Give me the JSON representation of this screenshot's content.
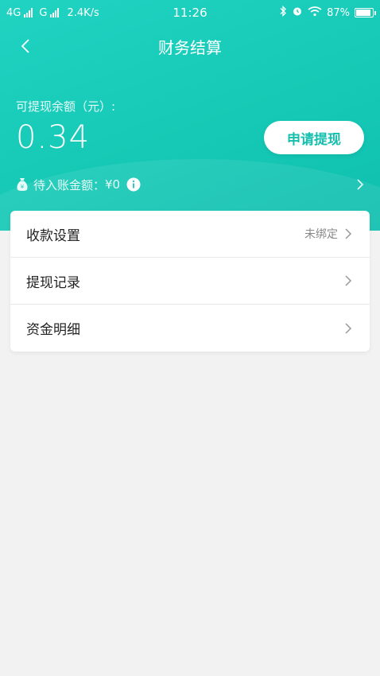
{
  "status_bar": {
    "network1": "4G",
    "network2": "G",
    "speed": "2.4K/s",
    "time": "11:26",
    "battery": "87%"
  },
  "header": {
    "title": "财务结算",
    "balance_label": "可提现余额（元）:",
    "balance_value": "0.34",
    "withdraw_button": "申请提现",
    "pending_label": "待入账金额：",
    "pending_value": "¥0"
  },
  "menu": {
    "items": [
      {
        "label": "收款设置",
        "status": "未绑定"
      },
      {
        "label": "提现记录"
      },
      {
        "label": "资金明细"
      }
    ]
  },
  "colors": {
    "accent": "#14bfae",
    "header_start": "#20d3c2",
    "header_end": "#0fbfae"
  }
}
